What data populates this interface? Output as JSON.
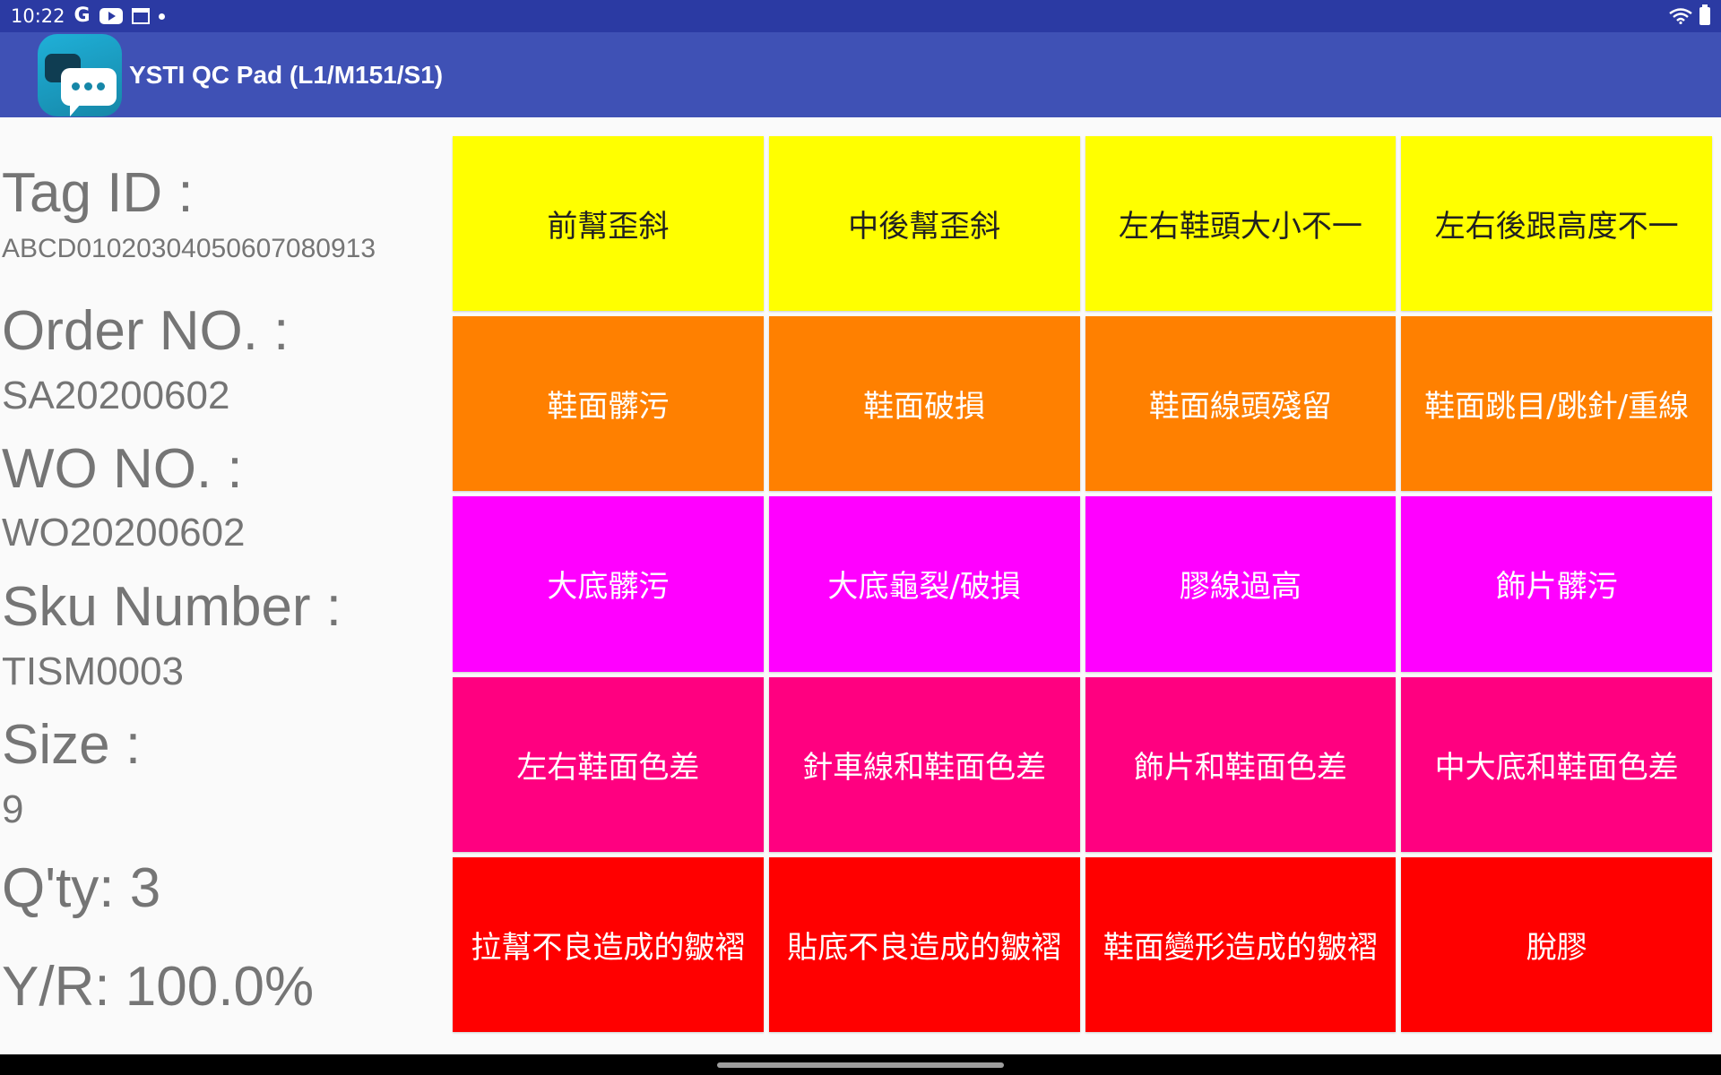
{
  "status_bar": {
    "time": "10:22",
    "icons": [
      "google-icon",
      "youtube-icon",
      "calendar-icon",
      "dot-icon",
      "wifi-icon",
      "battery-icon"
    ],
    "google_glyph": "G"
  },
  "app_bar": {
    "title": "YSTI QC Pad (L1/M151/S1)",
    "color": "#3f51b5"
  },
  "info": {
    "tag_id_label": "Tag ID :",
    "tag_id_value": "ABCD010203040506070809 13",
    "order_no_label": "Order NO. :",
    "order_no_value": "SA20200602",
    "wo_no_label": "WO NO. :",
    "wo_no_value": "WO20200602",
    "sku_label": "Sku Number :",
    "sku_value": "TISM0003",
    "size_label": "Size :",
    "size_value": "9",
    "qty_text": "Q'ty: 3",
    "yr_text": "Y/R: 100.0%"
  },
  "defect_rows": [
    {
      "color": "#ffff00",
      "text_color": "#212121",
      "items": [
        "前幫歪斜",
        "中後幫歪斜",
        "左右鞋頭大小不一",
        "左右後跟高度不一"
      ]
    },
    {
      "color": "#ff8000",
      "text_color": "#ffffff",
      "items": [
        "鞋面髒污",
        "鞋面破損",
        "鞋面線頭殘留",
        "鞋面跳目/跳針/重線"
      ]
    },
    {
      "color": "#ff00ff",
      "text_color": "#ffffff",
      "items": [
        "大底髒污",
        "大底龜裂/破損",
        "膠線過高",
        "飾片髒污"
      ]
    },
    {
      "color": "#ff0080",
      "text_color": "#ffffff",
      "items": [
        "左右鞋面色差",
        "針車線和鞋面色差",
        "飾片和鞋面色差",
        "中大底和鞋面色差"
      ]
    },
    {
      "color": "#ff0000",
      "text_color": "#ffffff",
      "items": [
        "拉幫不良造成的皺褶",
        "貼底不良造成的皺褶",
        "鞋面變形造成的皺褶",
        "脫膠"
      ]
    }
  ]
}
